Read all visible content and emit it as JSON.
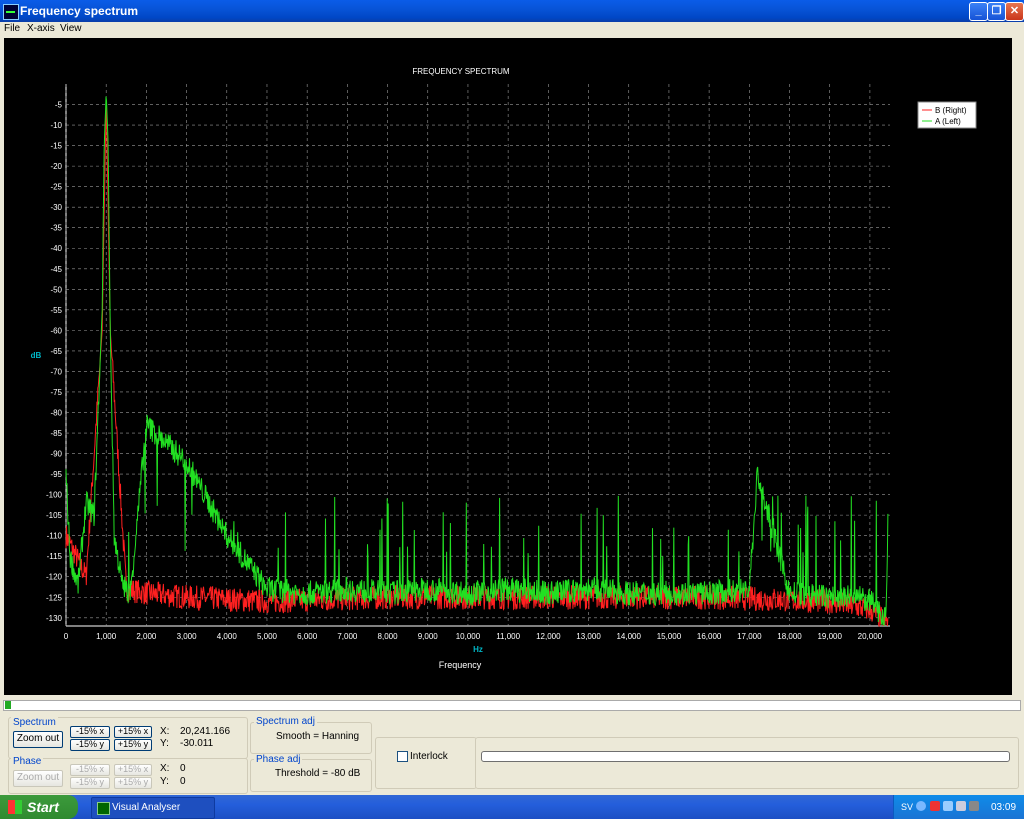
{
  "window": {
    "title": "Frequency spectrum"
  },
  "menu": [
    "File",
    "X-axis",
    "View"
  ],
  "chart_data": {
    "type": "line",
    "title": "FREQUENCY SPECTRUM",
    "xlabel": "Frequency",
    "xunit": "Hz",
    "ylabel": "dB",
    "xlim": [
      0,
      20500
    ],
    "ylim": [
      -132,
      0
    ],
    "xticks": [
      0,
      1000,
      2000,
      3000,
      4000,
      5000,
      6000,
      7000,
      8000,
      9000,
      10000,
      11000,
      12000,
      13000,
      14000,
      15000,
      16000,
      17000,
      18000,
      19000,
      20000
    ],
    "xtick_labels": [
      "0",
      "1,000",
      "2,000",
      "3,000",
      "4,000",
      "5,000",
      "6,000",
      "7,000",
      "8,000",
      "9,000",
      "10,000",
      "11,000",
      "12,000",
      "13,000",
      "14,000",
      "15,000",
      "16,000",
      "17,000",
      "18,000",
      "19,000",
      "20,000"
    ],
    "yticks": [
      -5,
      -10,
      -15,
      -20,
      -25,
      -30,
      -35,
      -40,
      -45,
      -50,
      -55,
      -60,
      -65,
      -70,
      -75,
      -80,
      -85,
      -90,
      -95,
      -100,
      -105,
      -110,
      -115,
      -120,
      -125,
      -130
    ],
    "grid": true,
    "legend_position": "top-right",
    "series": [
      {
        "name": "B (Right)",
        "color": "#ff2020",
        "x": [
          0,
          500,
          900,
          1000,
          1100,
          1500,
          2000,
          3000,
          5000,
          8000,
          12000,
          16000,
          19000,
          20000,
          20400
        ],
        "y": [
          -110,
          -120,
          -60,
          -3,
          -60,
          -123,
          -124,
          -125,
          -126,
          -125,
          -125,
          -125,
          -126,
          -128,
          -131
        ]
      },
      {
        "name": "A (Left)",
        "color": "#22e022",
        "x": [
          0,
          100,
          300,
          500,
          700,
          900,
          950,
          1000,
          1050,
          1100,
          1200,
          1400,
          1600,
          2000,
          3000,
          4000,
          5000,
          6000,
          7000,
          8000,
          9000,
          10000,
          11000,
          12000,
          13000,
          14000,
          15000,
          16000,
          17000,
          17200,
          18000,
          19000,
          19700,
          20000,
          20400,
          20450
        ],
        "y": [
          -95,
          -115,
          -122,
          -102,
          -105,
          -55,
          -15,
          -2,
          -15,
          -60,
          -110,
          -122,
          -124,
          -83,
          -92,
          -110,
          -123,
          -124,
          -123,
          -124,
          -123,
          -124,
          -123,
          -124,
          -123,
          -124,
          -124,
          -124,
          -123,
          -95,
          -124,
          -125,
          -125,
          -126,
          -130,
          -105
        ]
      }
    ]
  },
  "controls": {
    "spectrum": {
      "legend": "Spectrum",
      "zoom_out": "Zoom out",
      "minus_x": "-15% x",
      "plus_x": "+15% x",
      "minus_y": "-15% y",
      "plus_y": "+15% y",
      "x_label": "X:",
      "x_value": "20,241.166",
      "y_label": "Y:",
      "y_value": "-30.011"
    },
    "phase": {
      "legend": "Phase",
      "zoom_out": "Zoom out",
      "minus_x": "-15% x",
      "plus_x": "+15% x",
      "minus_y": "-15% y",
      "plus_y": "+15% y",
      "x_label": "X:",
      "x_value": "0",
      "y_label": "Y:",
      "y_value": "0"
    },
    "spectrum_adj": {
      "legend": "Spectrum adj",
      "text": "Smooth = Hanning"
    },
    "phase_adj": {
      "legend": "Phase adj",
      "text": "Threshold = -80 dB"
    },
    "interlock_label": "Interlock"
  },
  "taskbar": {
    "start": "Start",
    "task": "Visual Analyser",
    "lang": "SV",
    "clock": "03:09"
  }
}
